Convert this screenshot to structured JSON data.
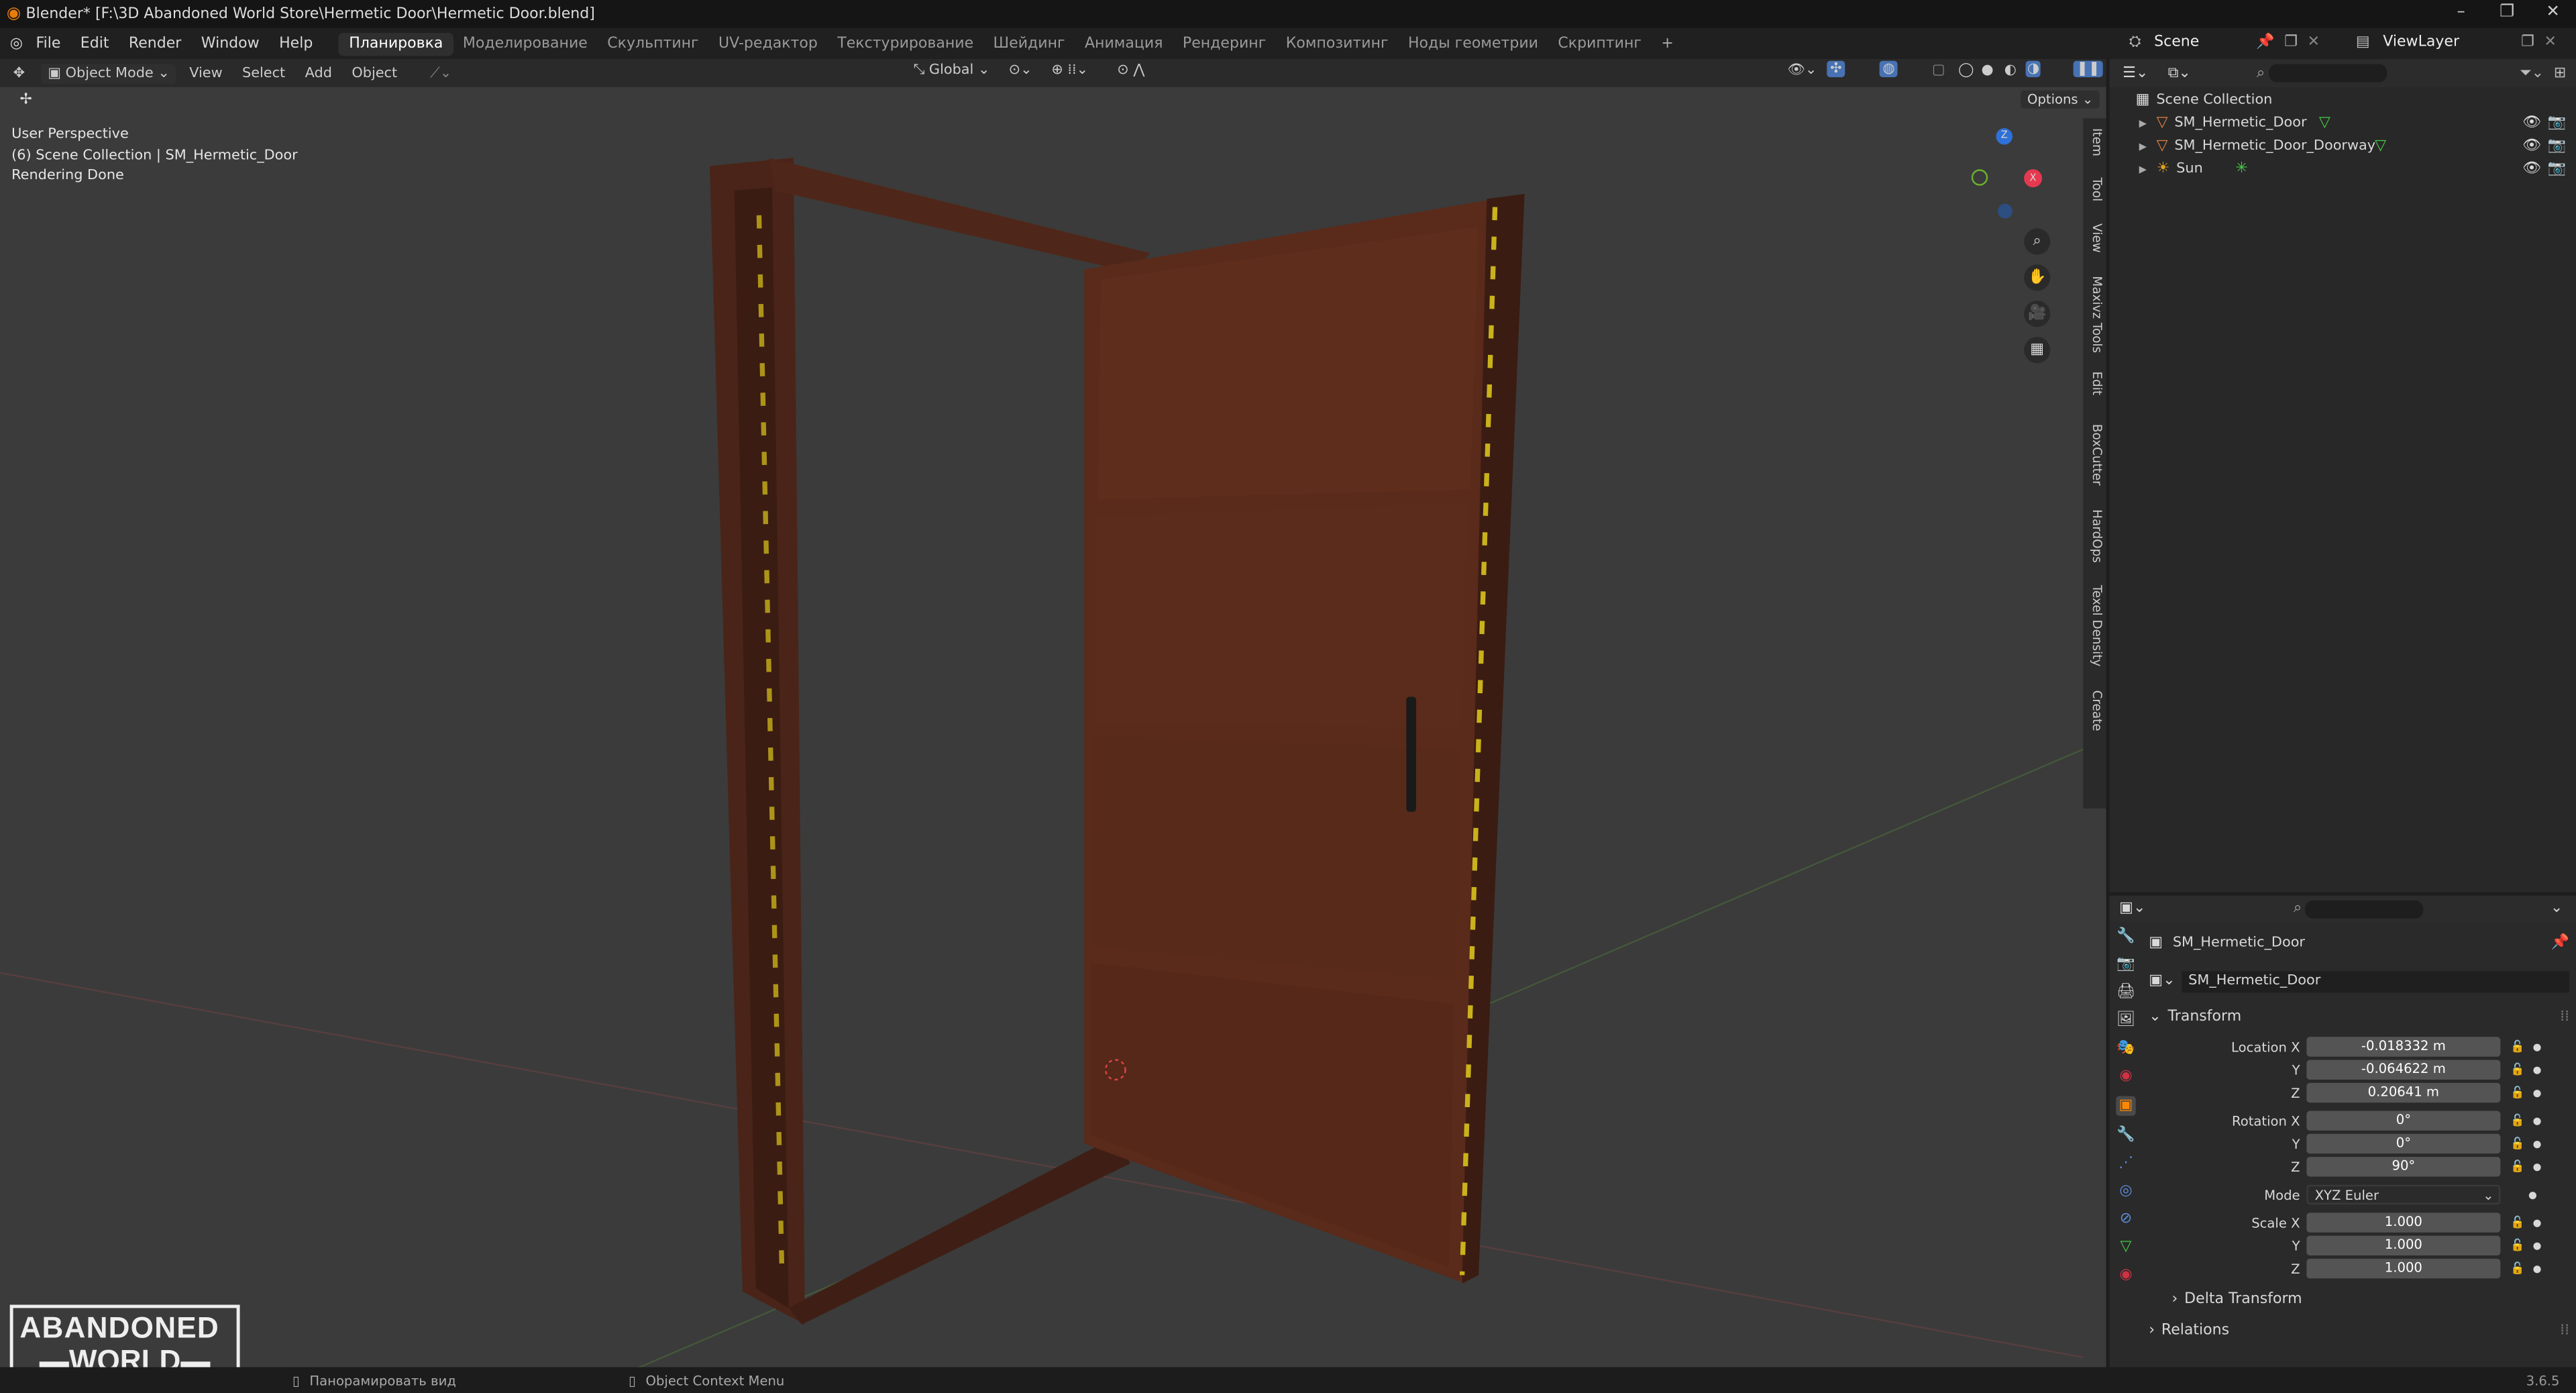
{
  "window": {
    "title": "Blender* [F:\\3D Abandoned World Store\\Hermetic Door\\Hermetic Door.blend]"
  },
  "menu": [
    "File",
    "Edit",
    "Render",
    "Window",
    "Help"
  ],
  "workspaces": [
    {
      "label": "Планировка",
      "active": true
    },
    {
      "label": "Моделирование"
    },
    {
      "label": "Скульптинг"
    },
    {
      "label": "UV-редактор"
    },
    {
      "label": "Текстурирование"
    },
    {
      "label": "Шейдинг"
    },
    {
      "label": "Анимация"
    },
    {
      "label": "Рендеринг"
    },
    {
      "label": "Композитинг"
    },
    {
      "label": "Ноды геометрии"
    },
    {
      "label": "Скриптинг"
    }
  ],
  "scene": {
    "label": "Scene",
    "view_layer": "ViewLayer"
  },
  "viewport_header": {
    "mode": "Object Mode",
    "items": [
      "View",
      "Select",
      "Add",
      "Object"
    ],
    "orientation": "Global",
    "options": "Options"
  },
  "overlay": [
    "User Perspective",
    "(6) Scene Collection | SM_Hermetic_Door",
    "Rendering Done"
  ],
  "sidebar_tabs": [
    "Item",
    "Tool",
    "View",
    "Maxivz Tools",
    "Edit",
    "BoxCutter",
    "HardOps",
    "Texel Density",
    "Create"
  ],
  "outliner": {
    "root": "Scene Collection",
    "items": [
      {
        "name": "SM_Hermetic_Door"
      },
      {
        "name": "SM_Hermetic_Door_Doorway"
      },
      {
        "name": "Sun"
      }
    ]
  },
  "properties": {
    "object_name": "SM_Hermetic_Door",
    "data_name": "SM_Hermetic_Door",
    "panel": "Transform",
    "location": {
      "label": "Location X",
      "x": "-0.018332 m",
      "y": "-0.064622 m",
      "z": "0.20641 m"
    },
    "rotation": {
      "label": "Rotation X",
      "x": "0°",
      "y": "0°",
      "z": "90°"
    },
    "mode": {
      "label": "Mode",
      "value": "XYZ Euler"
    },
    "scale": {
      "label": "Scale X",
      "x": "1.000",
      "y": "1.000",
      "z": "1.000"
    },
    "axis_y": "Y",
    "axis_z": "Z",
    "delta": "Delta Transform",
    "relations": "Relations"
  },
  "status": {
    "left": "Панорамировать вид",
    "middle": "Object Context Menu",
    "version": "3.6.5"
  },
  "gizmo": {
    "x": "X",
    "z": "Z"
  },
  "watermark": {
    "line1": "ABANDONED",
    "line2": "WORLD"
  },
  "colors": {
    "accent": "#4772b3",
    "door": "#5a2a1a",
    "frame": "#4a2418",
    "stripe": "#c9b21b"
  }
}
